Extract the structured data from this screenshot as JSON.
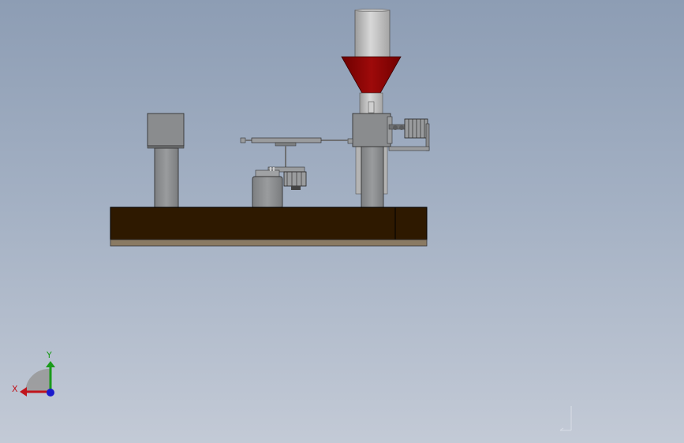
{
  "scene": {
    "background_top": "#8d9db4",
    "background_bottom": "#c3cad6",
    "colors": {
      "wood_base": "#2e1900",
      "wood_edge": "#1a0e00",
      "base_strip": "#8a7a63",
      "steel": "#8a8c8e",
      "steel_dark": "#5a5c5e",
      "hopper_red": "#8b0000",
      "silo_light": "#c9c9c9"
    }
  },
  "triad": {
    "x_label": "X",
    "y_label": "Y",
    "x_color": "#c0141c",
    "y_color": "#1a9a1a",
    "z_color": "#1a1acc"
  }
}
